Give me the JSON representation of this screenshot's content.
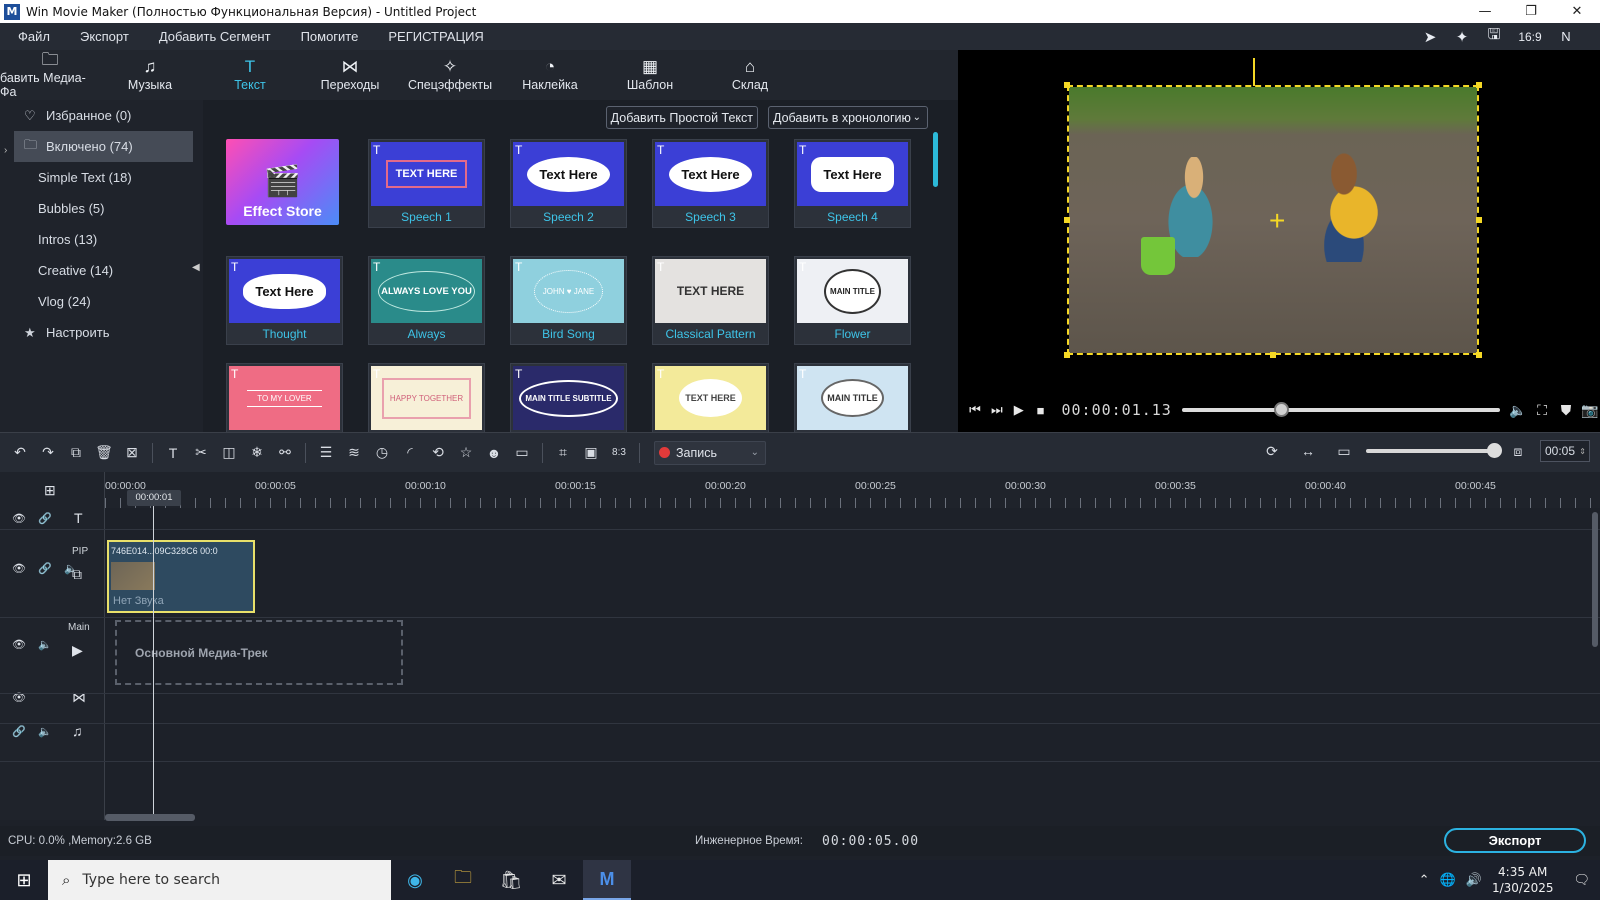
{
  "window": {
    "title": "Win Movie Maker (Полностью Функциональная Версия) - Untitled Project",
    "logo": "M",
    "minimize": "—",
    "maximize": "❐",
    "close": "✕"
  },
  "menu": {
    "items": [
      "Файл",
      "Экспорт",
      "Добавить Сегмент",
      "Помогите",
      "РЕГИСТРАЦИЯ"
    ],
    "right_icons": [
      "pin-icon",
      "star-magic-icon",
      "save-icon",
      "aspect-ratio-icon",
      "user-icon"
    ],
    "aspect_label": "16:9",
    "user_label": "N"
  },
  "tabs": [
    {
      "label": "бавить Медиа-Фа",
      "icon": "media-icon"
    },
    {
      "label": "Музыка",
      "icon": "music-icon"
    },
    {
      "label": "Текст",
      "icon": "text-icon",
      "active": true
    },
    {
      "label": "Переходы",
      "icon": "transition-icon"
    },
    {
      "label": "Спецэффекты",
      "icon": "effects-icon"
    },
    {
      "label": "Наклейка",
      "icon": "sticker-icon"
    },
    {
      "label": "Шаблон",
      "icon": "template-icon"
    },
    {
      "label": "Склад",
      "icon": "store-icon"
    }
  ],
  "categories": {
    "favorites": "Избранное (0)",
    "included": "Включено (74)",
    "items": [
      "Simple Text (18)",
      "Bubbles (5)",
      "Intros (13)",
      "Creative (14)",
      "Vlog (24)"
    ],
    "customize": "Настроить"
  },
  "effects_panel": {
    "add_simple_text": "Добавить Простой Текст",
    "add_to_timeline": "Добавить в хронологию",
    "store_label": "Effect Store",
    "tiles": [
      {
        "label": "Speech 1",
        "thumb_text": "TEXT HERE"
      },
      {
        "label": "Speech 2",
        "thumb_text": "Text Here"
      },
      {
        "label": "Speech 3",
        "thumb_text": "Text Here"
      },
      {
        "label": "Speech 4",
        "thumb_text": "Text Here"
      },
      {
        "label": "Thought",
        "thumb_text": "Text Here"
      },
      {
        "label": "Always",
        "thumb_text": "ALWAYS LOVE YOU"
      },
      {
        "label": "Bird Song",
        "thumb_text": "JOHN ♥ JANE"
      },
      {
        "label": "Classical Pattern",
        "thumb_text": "TEXT HERE"
      },
      {
        "label": "Flower",
        "thumb_text": "MAIN TITLE"
      },
      {
        "label": "",
        "thumb_text": "TO MY LOVER"
      },
      {
        "label": "",
        "thumb_text": "HAPPY TOGETHER"
      },
      {
        "label": "",
        "thumb_text": "MAIN TITLE SUBTITLE"
      },
      {
        "label": "",
        "thumb_text": "TEXT HERE"
      },
      {
        "label": "",
        "thumb_text": "MAIN TITLE"
      }
    ]
  },
  "player": {
    "timecode": "00:00:01.13",
    "seek_position": 0.31
  },
  "timeline_toolbar": {
    "record_label": "Запись",
    "zoom_value": "00:05",
    "zoom_level": 1.0
  },
  "ruler": {
    "labels": [
      "00:00:00",
      "00:00:05",
      "00:00:10",
      "00:00:15",
      "00:00:20",
      "00:00:25",
      "00:00:30",
      "00:00:35",
      "00:00:40",
      "00:00:45"
    ],
    "playhead_label": "00:00:01"
  },
  "tracks": {
    "pip_name": "PIP",
    "main_name": "Main",
    "pip_clip_caption": "746E014...09C328C6   00:0",
    "pip_clip_audio": "Нет Звука",
    "main_placeholder": "Основной Медиа-Трек"
  },
  "status": {
    "cpu": "CPU: 0.0% ,Memory:2.6 GB",
    "engineering_time_label": "Инженерное Время:",
    "engineering_time_value": "00:00:05.00",
    "export": "Экспорт"
  },
  "taskbar": {
    "search_placeholder": "Type here to search",
    "time": "4:35 AM",
    "date": "1/30/2025"
  }
}
